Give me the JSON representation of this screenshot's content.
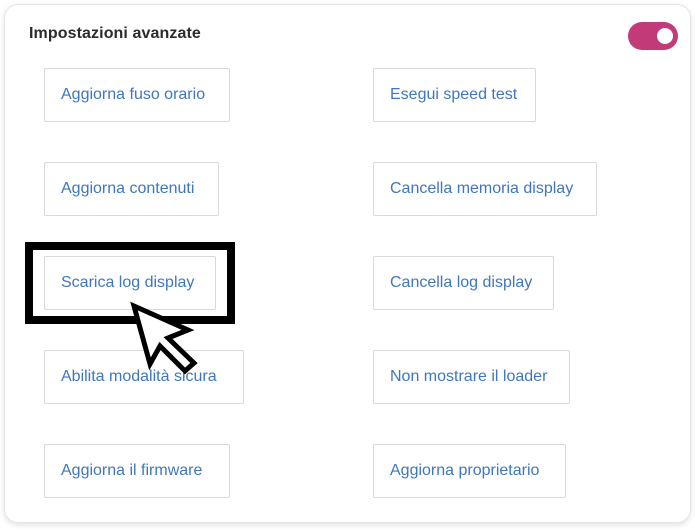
{
  "panel": {
    "title": "Impostazioni avanzate",
    "toggle_on": true,
    "toggle_color": "#c23b78"
  },
  "buttons": {
    "aggiorna_fuso_orario": "Aggiorna fuso orario",
    "esegui_speed_test": "Esegui speed test",
    "aggiorna_contenuti": "Aggiorna contenuti",
    "cancella_memoria_display": "Cancella memoria display",
    "scarica_log_display": "Scarica log display",
    "cancella_log_display": "Cancella log display",
    "abilita_modalita_sicura": "Abilita modalità sicura",
    "non_mostrare_loader": "Non mostrare il loader",
    "aggiorna_firmware": "Aggiorna il firmware",
    "aggiorna_proprietario": "Aggiorna proprietario"
  },
  "colors": {
    "button_text": "#3f76c2",
    "highlight": "#000000"
  }
}
